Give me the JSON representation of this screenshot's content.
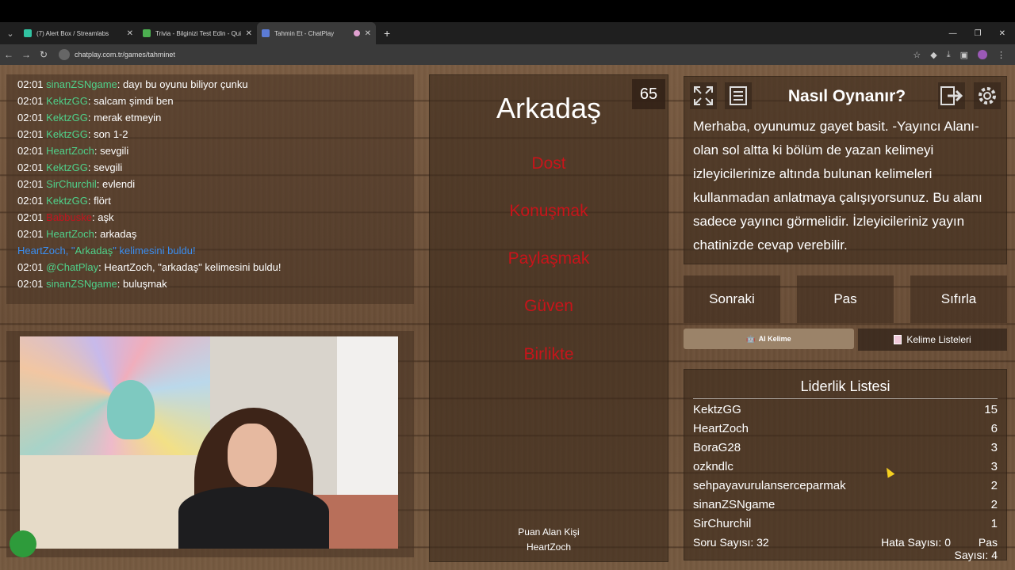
{
  "browser": {
    "tabs": [
      {
        "label": "(7) Alert Box / Streamlabs",
        "color": "#31c3a2"
      },
      {
        "label": "Trivia - Bilginizi Test Edin - Quiz",
        "color": "#4caf50"
      },
      {
        "label": "Tahmin Et - ChatPlay",
        "color": "#5b7bd5",
        "active": true
      }
    ],
    "url": "chatplay.com.tr/games/tahminet"
  },
  "chat": {
    "lines": [
      {
        "time": "02:01",
        "user": "sinanZSNgame",
        "msg": ": dayı bu oyunu biliyor çunku",
        "color": "green"
      },
      {
        "time": "02:01",
        "user": "KektzGG",
        "msg": ": salcam şimdi ben",
        "color": "green"
      },
      {
        "time": "02:01",
        "user": "KektzGG",
        "msg": ": merak etmeyin",
        "color": "green"
      },
      {
        "time": "02:01",
        "user": "KektzGG",
        "msg": ": son 1-2",
        "color": "green"
      },
      {
        "time": "02:01",
        "user": "HeartZoch",
        "msg": ": sevgili",
        "color": "green"
      },
      {
        "time": "02:01",
        "user": "KektzGG",
        "msg": ": sevgili",
        "color": "green"
      },
      {
        "time": "02:01",
        "user": "SirChurchil",
        "msg": ": evlendi",
        "color": "green"
      },
      {
        "time": "02:01",
        "user": "KektzGG",
        "msg": ": flört",
        "color": "green"
      },
      {
        "time": "02:01",
        "user": "Babbuske",
        "msg": ": aşk",
        "color": "red"
      },
      {
        "time": "02:01",
        "user": "HeartZoch",
        "msg": ": arkadaş",
        "color": "green"
      }
    ],
    "system_line": {
      "user": "HeartZoch",
      "sep": ", \"",
      "word": "Arkadaş",
      "rest": "\" kelimesini buldu!"
    },
    "bot_line": {
      "time": "02:01",
      "user": "@ChatPlay",
      "msg": ": HeartZoch, \"arkadaş\" kelimesini buldu!"
    },
    "last_line": {
      "time": "02:01",
      "user": "sinanZSNgame",
      "msg": ": buluşmak"
    }
  },
  "game": {
    "timer": "65",
    "word": "Arkadaş",
    "taboo_words": [
      "Dost",
      "Konuşmak",
      "Paylaşmak",
      "Güven",
      "Birlikte"
    ],
    "scorer_label": "Puan Alan Kişi",
    "scorer_name": "HeartZoch"
  },
  "howto": {
    "title": "Nasıl Oynanır?",
    "text": "Merhaba, oyunumuz gayet basit. -Yayıncı Alanı- olan sol altta ki bölüm de yazan kelimeyi izleyicilerinize altında bulunan kelimeleri kullanmadan anlatmaya çalışıyorsunuz. Bu alanı sadece yayıncı görmelidir. İzleyicileriniz yayın chatinizde cevap verebilir."
  },
  "actions": {
    "next": "Sonraki",
    "pass": "Pas",
    "reset": "Sıfırla",
    "ai_word": "AI Kelime",
    "word_lists": "Kelime Listeleri"
  },
  "leaderboard": {
    "title": "Liderlik Listesi",
    "rows": [
      {
        "name": "KektzGG",
        "score": "15"
      },
      {
        "name": "HeartZoch",
        "score": "6"
      },
      {
        "name": "BoraG28",
        "score": "3"
      },
      {
        "name": "ozkndlc",
        "score": "3"
      },
      {
        "name": "sehpayavurulanserceparmak",
        "score": "2"
      },
      {
        "name": "sinanZSNgame",
        "score": "2"
      },
      {
        "name": "SirChurchil",
        "score": "1"
      }
    ],
    "question_count": "Soru Sayısı: 32",
    "error_count": "Hata Sayısı: 0",
    "pass_count": "Pas Sayısı: 4"
  },
  "colors": {
    "taboo": "#c8141a",
    "username": "#4fd18a",
    "system": "#3b8ef0"
  }
}
